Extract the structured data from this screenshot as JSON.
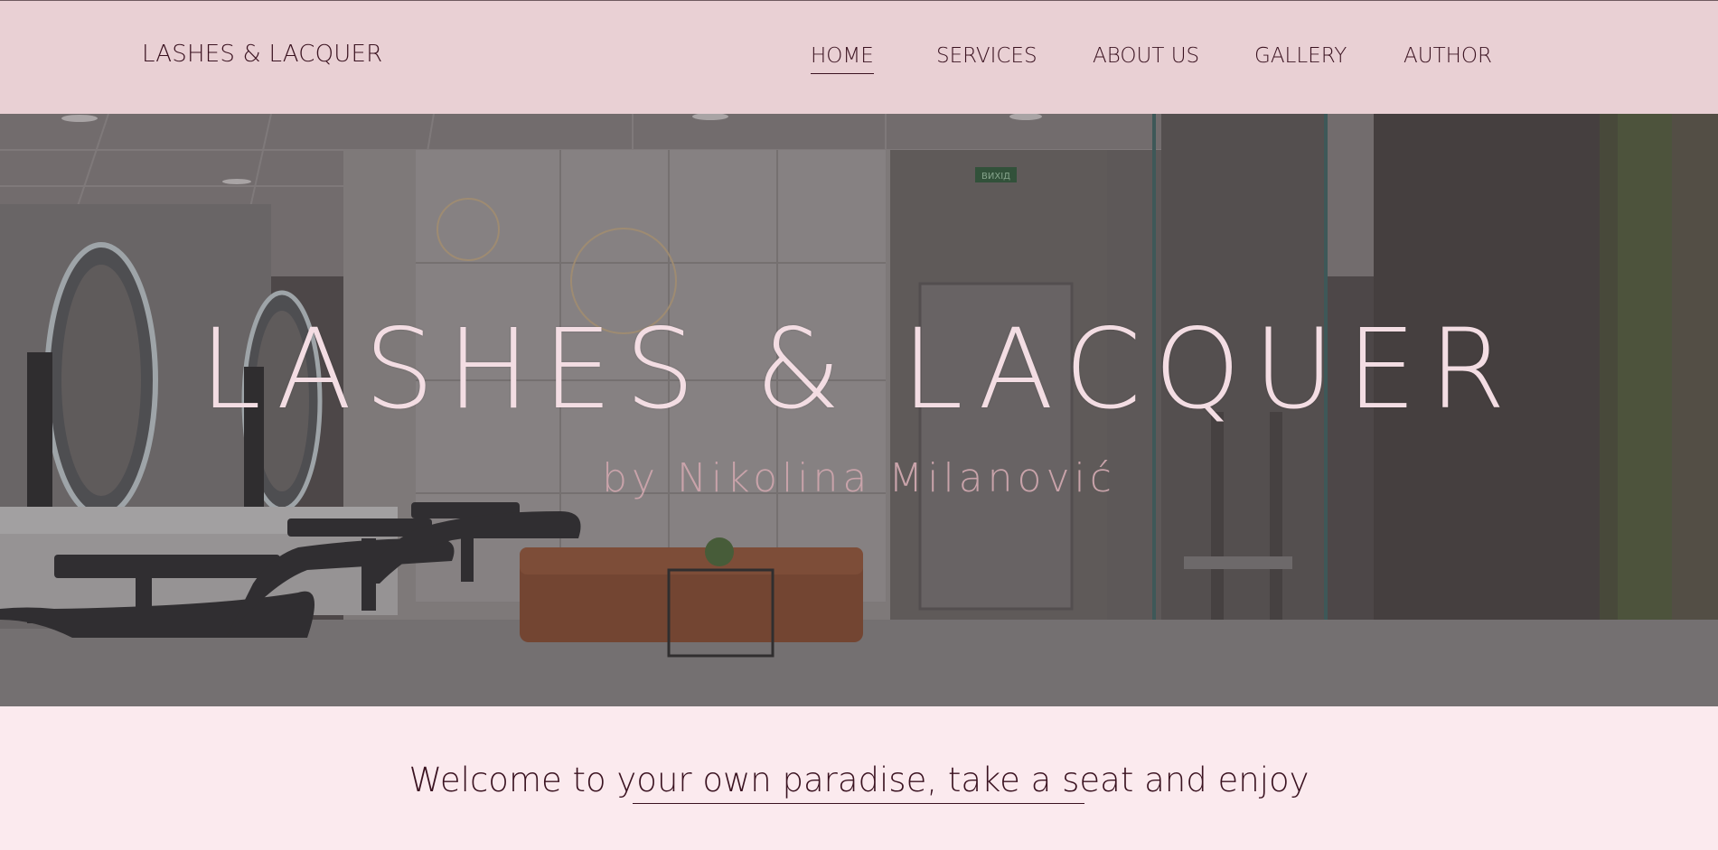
{
  "header": {
    "logo": "LASHES & LACQUER",
    "nav": [
      {
        "label": "HOME",
        "active": true
      },
      {
        "label": "SERVICES",
        "active": false
      },
      {
        "label": "ABOUT US",
        "active": false
      },
      {
        "label": "GALLERY",
        "active": false
      },
      {
        "label": "AUTHOR",
        "active": false
      }
    ]
  },
  "hero": {
    "title": "LASHES & LACQUER",
    "subtitle": "by Nikolina Milanović",
    "exit_sign": "ВИХІД"
  },
  "welcome": {
    "text": "Welcome to your own paradise, take a seat and enjoy"
  },
  "colors": {
    "header_bg": "#e9d0d4",
    "page_bg": "#fbeaee",
    "text_dark": "#3a1220",
    "hero_title": "#f3dde3",
    "hero_subtitle": "#c9a3aa"
  }
}
